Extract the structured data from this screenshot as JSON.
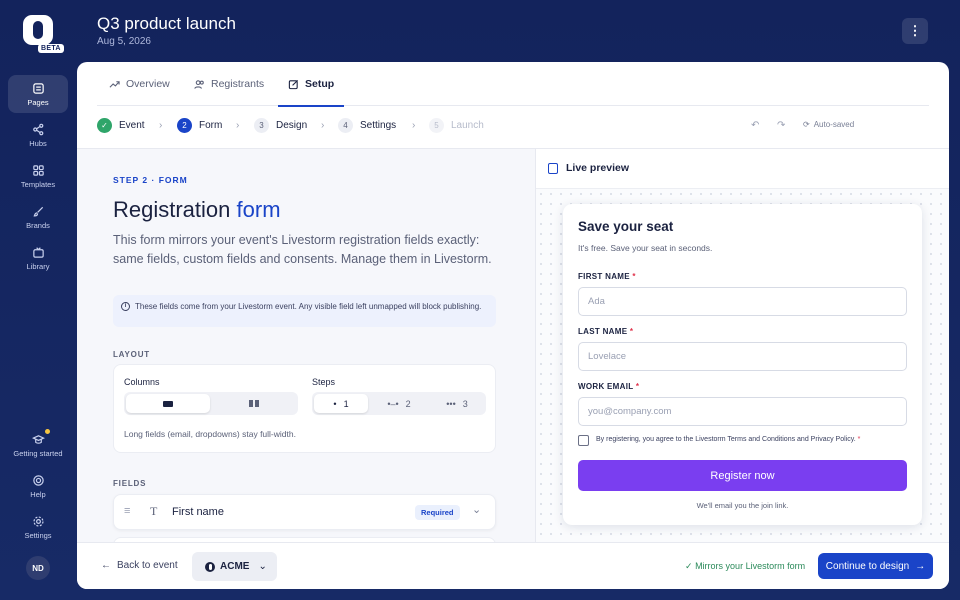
{
  "rail": {
    "beta": "BETA",
    "items": [
      {
        "label": "Pages",
        "icon": "pages-icon"
      },
      {
        "label": "Hubs",
        "icon": "share-icon"
      },
      {
        "label": "Templates",
        "icon": "templates-icon"
      },
      {
        "label": "Brands",
        "icon": "brush-icon"
      },
      {
        "label": "Library",
        "icon": "tv-icon"
      },
      {
        "label": "Getting started",
        "icon": "graduation-cap-icon"
      },
      {
        "label": "Help",
        "icon": "lifebuoy-icon"
      },
      {
        "label": "Settings",
        "icon": "gear-icon"
      }
    ],
    "avatar": "ND"
  },
  "header": {
    "title": "Q3 product launch",
    "date": "Aug 5, 2026",
    "menu_icon": "⋮"
  },
  "tabs": [
    {
      "label": "Overview",
      "icon": "trend-icon"
    },
    {
      "label": "Registrants",
      "icon": "users-icon"
    },
    {
      "label": "Setup",
      "icon": "edit-icon"
    }
  ],
  "steps": [
    {
      "num": "✓",
      "label": "Event"
    },
    {
      "num": "2",
      "label": "Form"
    },
    {
      "num": "3",
      "label": "Design"
    },
    {
      "num": "4",
      "label": "Settings"
    },
    {
      "num": "5",
      "label": "Launch"
    }
  ],
  "autosave": "Auto-saved",
  "form_panel": {
    "eyebrow": "STEP 2 · FORM",
    "title_a": "Registration",
    "title_b": "form",
    "lead": "This form mirrors your event's Livestorm registration fields exactly: same fields, custom fields and consents. Manage them in Livestorm.",
    "info": "These fields come from your Livestorm event. Any visible field left unmapped will block publishing.",
    "layout_label": "LAYOUT",
    "columns_label": "Columns",
    "steps_label": "Steps",
    "step_options": [
      "1",
      "2",
      "3"
    ],
    "layout_note": "Long fields (email, dropdowns) stay full-width.",
    "fields_label": "FIELDS",
    "field1": {
      "name": "First name",
      "badge": "Required"
    }
  },
  "preview": {
    "title": "Live preview",
    "form_title": "Save your seat",
    "form_sub": "It's free. Save your seat in seconds.",
    "fields": [
      {
        "label": "FIRST NAME",
        "placeholder": "Ada"
      },
      {
        "label": "LAST NAME",
        "placeholder": "Lovelace"
      },
      {
        "label": "WORK EMAIL",
        "placeholder": "you@company.com"
      }
    ],
    "required_mark": "*",
    "consent": "By registering, you agree to the Livestorm Terms and Conditions and Privacy Policy.",
    "button": "Register now",
    "footnote": "We'll email you the join link."
  },
  "bottom": {
    "back": "Back to event",
    "brand": "ACME",
    "mirrors": "Mirrors your Livestorm form",
    "continue": "Continue to design"
  },
  "colors": {
    "accent": "#1a44c8",
    "cta": "#7a3ef0",
    "success": "#2fa56a",
    "rail_bg": "#13235c"
  }
}
